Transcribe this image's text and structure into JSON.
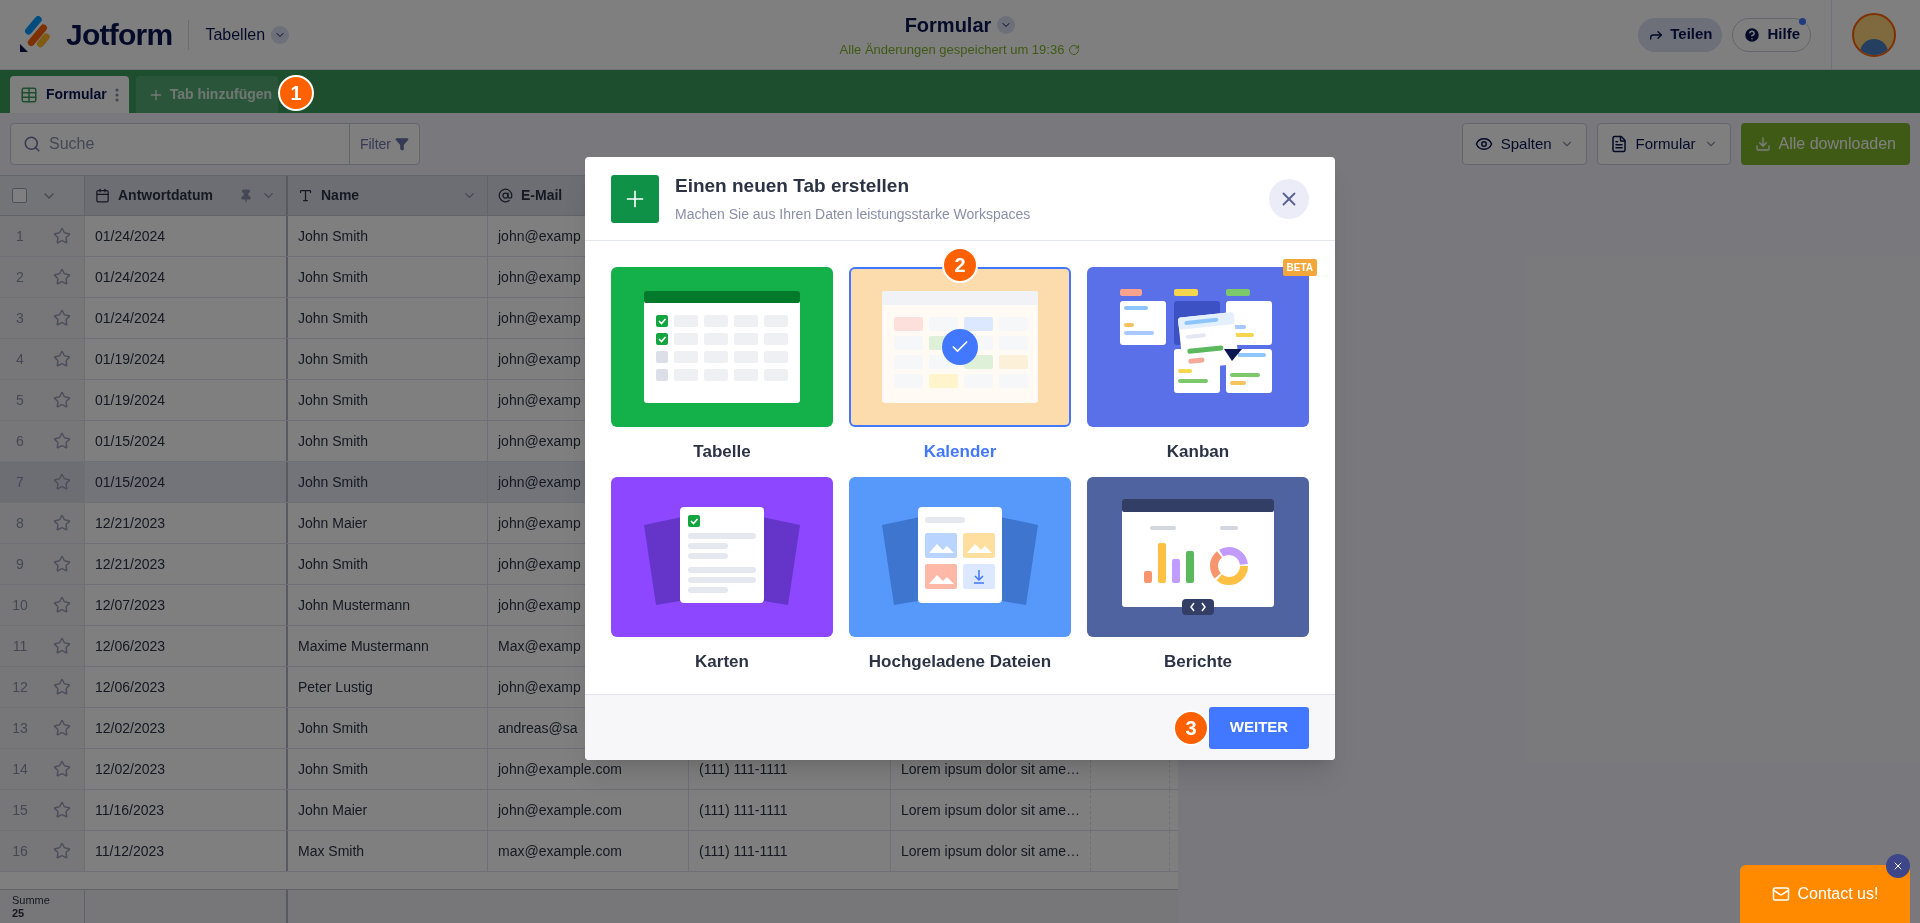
{
  "header": {
    "brand": "Jotform",
    "section": "Tabellen",
    "form_title": "Formular",
    "save_status": "Alle Änderungen gespeichert um 19:36",
    "share": "Teilen",
    "help": "Hilfe",
    "help_notification": true
  },
  "tab_bar": {
    "tabs": [
      {
        "label": "Formular",
        "selected": true
      }
    ],
    "add_tab": {
      "label": "Tab hinzufügen",
      "step": "1"
    }
  },
  "toolbar": {
    "search_placeholder": "Suche",
    "filter": "Filter",
    "columns_button": "Spalten",
    "form_button": "Formular",
    "download_button": "Alle downloaden"
  },
  "table": {
    "select_all_checked": false,
    "columns": [
      {
        "label": "Antwortdatum",
        "kind": "date",
        "pinned": true
      },
      {
        "label": "Name",
        "kind": "text",
        "pinned": false
      },
      {
        "label": "E-Mail",
        "kind": "email",
        "pinned": false
      }
    ],
    "rows": [
      {
        "number": "1",
        "highlighted": false,
        "date": "01/24/2024",
        "name": "John Smith",
        "email": "john@examp"
      },
      {
        "number": "2",
        "highlighted": false,
        "date": "01/24/2024",
        "name": "John Smith",
        "email": "john@examp"
      },
      {
        "number": "3",
        "highlighted": false,
        "date": "01/24/2024",
        "name": "John Smith",
        "email": "john@examp"
      },
      {
        "number": "4",
        "highlighted": false,
        "date": "01/19/2024",
        "name": "John Smith",
        "email": "john@examp"
      },
      {
        "number": "5",
        "highlighted": false,
        "date": "01/19/2024",
        "name": "John Smith",
        "email": "john@examp"
      },
      {
        "number": "6",
        "highlighted": false,
        "date": "01/15/2024",
        "name": "John Smith",
        "email": "john@examp"
      },
      {
        "number": "7",
        "highlighted": true,
        "date": "01/15/2024",
        "name": "John Smith",
        "email": "john@examp"
      },
      {
        "number": "8",
        "highlighted": false,
        "date": "12/21/2023",
        "name": "John Maier",
        "email": "john@examp"
      },
      {
        "number": "9",
        "highlighted": false,
        "date": "12/21/2023",
        "name": "John Smith",
        "email": "john@examp"
      },
      {
        "number": "10",
        "highlighted": false,
        "date": "12/07/2023",
        "name": "John Mustermann",
        "email": "john@examp"
      },
      {
        "number": "11",
        "highlighted": false,
        "date": "12/06/2023",
        "name": "Maxime Mustermann",
        "email": "Max@examp"
      },
      {
        "number": "12",
        "highlighted": false,
        "date": "12/06/2023",
        "name": "Peter Lustig",
        "email": "john@examp"
      },
      {
        "number": "13",
        "highlighted": false,
        "date": "12/02/2023",
        "name": "John Smith",
        "email": "andreas@sa"
      },
      {
        "number": "14",
        "highlighted": false,
        "date": "12/02/2023",
        "name": "John Smith",
        "email": "john@example.com",
        "phone": "(111) 111-1111",
        "note": "Lorem ipsum dolor sit ame…"
      },
      {
        "number": "15",
        "highlighted": false,
        "date": "11/16/2023",
        "name": "John Maier",
        "email": "john@example.com",
        "phone": "(111) 111-1111",
        "note": "Lorem ipsum dolor sit ame…"
      },
      {
        "number": "16",
        "highlighted": false,
        "date": "11/12/2023",
        "name": "Max Smith",
        "email": "max@example.com",
        "phone": "(111) 111-1111",
        "note": "Lorem ipsum dolor sit ame…"
      }
    ],
    "footer": {
      "label": "Summe",
      "value": "25"
    }
  },
  "modal": {
    "title": "Einen neuen Tab erstellen",
    "subtitle": "Machen Sie aus Ihren Daten leistungsstarke Workspaces",
    "options": [
      {
        "label": "Tabelle",
        "kind": "table",
        "selected": false,
        "color": "#14b04a"
      },
      {
        "label": "Kalender",
        "kind": "calendar",
        "selected": true,
        "color": "#fcdcad",
        "step": "2"
      },
      {
        "label": "Kanban",
        "kind": "kanban",
        "selected": false,
        "color": "#5a70e9",
        "badge": "BETA"
      },
      {
        "label": "Karten",
        "kind": "cards",
        "selected": false,
        "color": "#8c47ff"
      },
      {
        "label": "Hochgeladene Dateien",
        "kind": "uploads",
        "selected": false,
        "color": "#5699fa"
      },
      {
        "label": "Berichte",
        "kind": "reports",
        "selected": false,
        "color": "#4f63a0"
      }
    ],
    "primary_button": {
      "label": "WEITER",
      "step": "3"
    }
  },
  "contact": {
    "label": "Contact us!"
  }
}
